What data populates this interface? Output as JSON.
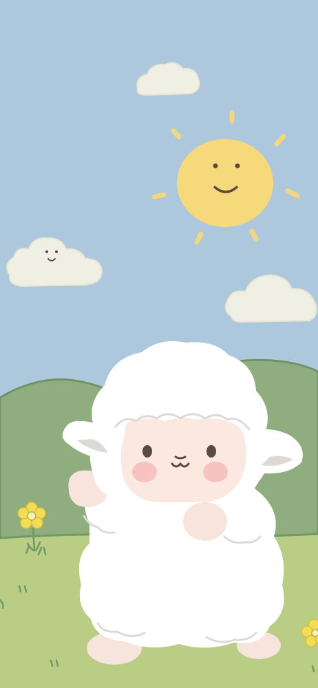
{
  "scene": {
    "sky_color": "#adc8dc",
    "hill_color": "#90ad80",
    "grass_color": "#b9cd84",
    "sun_color": "#f6d97a",
    "sun_ray_color": "#f3d77e",
    "cloud_color": "#f0efe3",
    "sheep_wool_color": "#ffffff",
    "sheep_face_color": "#fbe9e1",
    "cheek_color": "#f7c3c1",
    "flower_color": "#f3dd56",
    "stem_color": "#6d9a67",
    "outline_color": "#5c4a40"
  }
}
